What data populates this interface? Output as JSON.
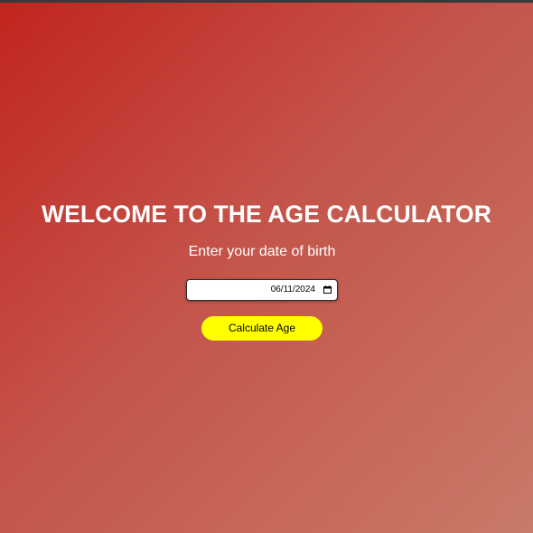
{
  "page": {
    "title": "WELCOME TO THE AGE CALCULATOR",
    "subtitle": "Enter your date of birth"
  },
  "form": {
    "date_value": "06/11/2024",
    "button_label": "Calculate Age"
  },
  "icons": {
    "date_picker": "calendar-icon"
  },
  "colors": {
    "background_start": "#c2241f",
    "background_end": "#c87a68",
    "title_text": "#ffffff",
    "button_bg": "#ffff00",
    "button_text": "#000000"
  }
}
